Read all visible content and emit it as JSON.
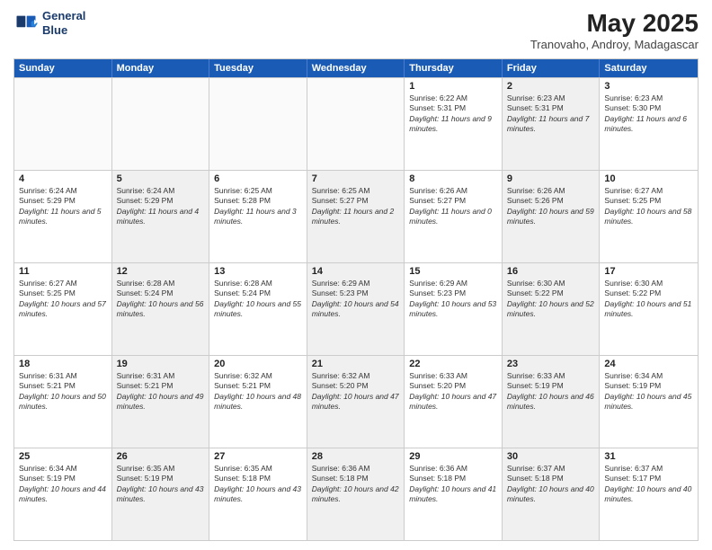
{
  "header": {
    "logo_line1": "General",
    "logo_line2": "Blue",
    "title": "May 2025",
    "subtitle": "Tranovaho, Androy, Madagascar"
  },
  "weekdays": [
    "Sunday",
    "Monday",
    "Tuesday",
    "Wednesday",
    "Thursday",
    "Friday",
    "Saturday"
  ],
  "rows": [
    [
      {
        "day": "",
        "info": "",
        "shaded": false,
        "empty": true
      },
      {
        "day": "",
        "info": "",
        "shaded": false,
        "empty": true
      },
      {
        "day": "",
        "info": "",
        "shaded": false,
        "empty": true
      },
      {
        "day": "",
        "info": "",
        "shaded": false,
        "empty": true
      },
      {
        "day": "1",
        "sunrise": "6:22 AM",
        "sunset": "5:31 PM",
        "daylight": "11 hours and 9 minutes.",
        "shaded": false
      },
      {
        "day": "2",
        "sunrise": "6:23 AM",
        "sunset": "5:31 PM",
        "daylight": "11 hours and 7 minutes.",
        "shaded": true
      },
      {
        "day": "3",
        "sunrise": "6:23 AM",
        "sunset": "5:30 PM",
        "daylight": "11 hours and 6 minutes.",
        "shaded": false
      }
    ],
    [
      {
        "day": "4",
        "sunrise": "6:24 AM",
        "sunset": "5:29 PM",
        "daylight": "11 hours and 5 minutes.",
        "shaded": false
      },
      {
        "day": "5",
        "sunrise": "6:24 AM",
        "sunset": "5:29 PM",
        "daylight": "11 hours and 4 minutes.",
        "shaded": true
      },
      {
        "day": "6",
        "sunrise": "6:25 AM",
        "sunset": "5:28 PM",
        "daylight": "11 hours and 3 minutes.",
        "shaded": false
      },
      {
        "day": "7",
        "sunrise": "6:25 AM",
        "sunset": "5:27 PM",
        "daylight": "11 hours and 2 minutes.",
        "shaded": true
      },
      {
        "day": "8",
        "sunrise": "6:26 AM",
        "sunset": "5:27 PM",
        "daylight": "11 hours and 0 minutes.",
        "shaded": false
      },
      {
        "day": "9",
        "sunrise": "6:26 AM",
        "sunset": "5:26 PM",
        "daylight": "10 hours and 59 minutes.",
        "shaded": true
      },
      {
        "day": "10",
        "sunrise": "6:27 AM",
        "sunset": "5:25 PM",
        "daylight": "10 hours and 58 minutes.",
        "shaded": false
      }
    ],
    [
      {
        "day": "11",
        "sunrise": "6:27 AM",
        "sunset": "5:25 PM",
        "daylight": "10 hours and 57 minutes.",
        "shaded": false
      },
      {
        "day": "12",
        "sunrise": "6:28 AM",
        "sunset": "5:24 PM",
        "daylight": "10 hours and 56 minutes.",
        "shaded": true
      },
      {
        "day": "13",
        "sunrise": "6:28 AM",
        "sunset": "5:24 PM",
        "daylight": "10 hours and 55 minutes.",
        "shaded": false
      },
      {
        "day": "14",
        "sunrise": "6:29 AM",
        "sunset": "5:23 PM",
        "daylight": "10 hours and 54 minutes.",
        "shaded": true
      },
      {
        "day": "15",
        "sunrise": "6:29 AM",
        "sunset": "5:23 PM",
        "daylight": "10 hours and 53 minutes.",
        "shaded": false
      },
      {
        "day": "16",
        "sunrise": "6:30 AM",
        "sunset": "5:22 PM",
        "daylight": "10 hours and 52 minutes.",
        "shaded": true
      },
      {
        "day": "17",
        "sunrise": "6:30 AM",
        "sunset": "5:22 PM",
        "daylight": "10 hours and 51 minutes.",
        "shaded": false
      }
    ],
    [
      {
        "day": "18",
        "sunrise": "6:31 AM",
        "sunset": "5:21 PM",
        "daylight": "10 hours and 50 minutes.",
        "shaded": false
      },
      {
        "day": "19",
        "sunrise": "6:31 AM",
        "sunset": "5:21 PM",
        "daylight": "10 hours and 49 minutes.",
        "shaded": true
      },
      {
        "day": "20",
        "sunrise": "6:32 AM",
        "sunset": "5:21 PM",
        "daylight": "10 hours and 48 minutes.",
        "shaded": false
      },
      {
        "day": "21",
        "sunrise": "6:32 AM",
        "sunset": "5:20 PM",
        "daylight": "10 hours and 47 minutes.",
        "shaded": true
      },
      {
        "day": "22",
        "sunrise": "6:33 AM",
        "sunset": "5:20 PM",
        "daylight": "10 hours and 47 minutes.",
        "shaded": false
      },
      {
        "day": "23",
        "sunrise": "6:33 AM",
        "sunset": "5:19 PM",
        "daylight": "10 hours and 46 minutes.",
        "shaded": true
      },
      {
        "day": "24",
        "sunrise": "6:34 AM",
        "sunset": "5:19 PM",
        "daylight": "10 hours and 45 minutes.",
        "shaded": false
      }
    ],
    [
      {
        "day": "25",
        "sunrise": "6:34 AM",
        "sunset": "5:19 PM",
        "daylight": "10 hours and 44 minutes.",
        "shaded": false
      },
      {
        "day": "26",
        "sunrise": "6:35 AM",
        "sunset": "5:19 PM",
        "daylight": "10 hours and 43 minutes.",
        "shaded": true
      },
      {
        "day": "27",
        "sunrise": "6:35 AM",
        "sunset": "5:18 PM",
        "daylight": "10 hours and 43 minutes.",
        "shaded": false
      },
      {
        "day": "28",
        "sunrise": "6:36 AM",
        "sunset": "5:18 PM",
        "daylight": "10 hours and 42 minutes.",
        "shaded": true
      },
      {
        "day": "29",
        "sunrise": "6:36 AM",
        "sunset": "5:18 PM",
        "daylight": "10 hours and 41 minutes.",
        "shaded": false
      },
      {
        "day": "30",
        "sunrise": "6:37 AM",
        "sunset": "5:18 PM",
        "daylight": "10 hours and 40 minutes.",
        "shaded": true
      },
      {
        "day": "31",
        "sunrise": "6:37 AM",
        "sunset": "5:17 PM",
        "daylight": "10 hours and 40 minutes.",
        "shaded": false
      }
    ]
  ]
}
